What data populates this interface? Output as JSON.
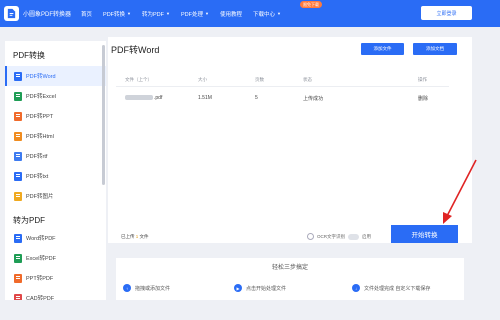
{
  "header": {
    "logo_text": "小圆象PDF转换器",
    "nav": [
      {
        "label": "首页",
        "has_caret": false
      },
      {
        "label": "PDF转换",
        "has_caret": true
      },
      {
        "label": "转为PDF",
        "has_caret": true
      },
      {
        "label": "PDF处理",
        "has_caret": true
      },
      {
        "label": "使用教程",
        "has_caret": false
      },
      {
        "label": "下载中心",
        "has_caret": true
      }
    ],
    "hot_badge": "限免下载",
    "login_label": "立即登录"
  },
  "sidebar": {
    "section1_title": "PDF转换",
    "section1_items": [
      {
        "label": "PDF转Word",
        "color": "#2a6cf5",
        "active": true
      },
      {
        "label": "PDF转Excel",
        "color": "#1f9d55",
        "active": false
      },
      {
        "label": "PDF转PPT",
        "color": "#f06a2a",
        "active": false
      },
      {
        "label": "PDF转Html",
        "color": "#f08c1f",
        "active": false
      },
      {
        "label": "PDF转rtf",
        "color": "#3d7bf0",
        "active": false
      },
      {
        "label": "PDF转txt",
        "color": "#2a6cf5",
        "active": false
      },
      {
        "label": "PDF转图片",
        "color": "#f0a91f",
        "active": false
      }
    ],
    "section2_title": "转为PDF",
    "section2_items": [
      {
        "label": "Word转PDF",
        "color": "#2a6cf5"
      },
      {
        "label": "Excel转PDF",
        "color": "#1f9d55"
      },
      {
        "label": "PPT转PDF",
        "color": "#f06a2a"
      },
      {
        "label": "CAD转PDF",
        "color": "#e04848"
      }
    ]
  },
  "main": {
    "title": "PDF转Word",
    "add_file_label": "添加文件",
    "add_folder_label": "添加文档",
    "table": {
      "headers": [
        "文件（上个）",
        "大小",
        "页数",
        "状态",
        "操作"
      ],
      "rows": [
        {
          "name_suffix": ".pdf",
          "size": "1.51M",
          "pages": "5",
          "status": "上传成功",
          "action": "删除"
        }
      ]
    },
    "uploaded_prefix": "已上传",
    "uploaded_count": "1",
    "uploaded_suffix": "文件",
    "ocr_label": "OCR文字识别",
    "ocr_switch_label": "启用",
    "start_label": "开始转换"
  },
  "steps": {
    "title": "轻松三步搞定",
    "items": [
      "拖拽或添加文件",
      "点击开始处理文件",
      "文件处理完成 自定义下载保存"
    ]
  },
  "colors": {
    "brand": "#2a6cf5",
    "annotation": "#e02424"
  }
}
